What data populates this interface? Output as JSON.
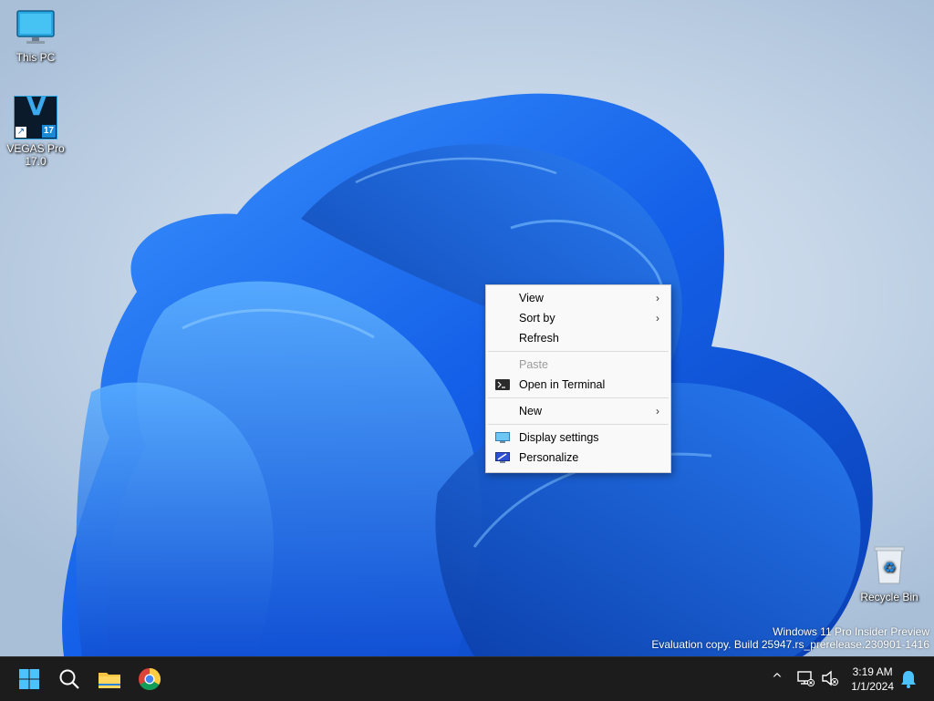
{
  "desktop": {
    "icons": {
      "this_pc": "This PC",
      "vegas_line1": "VEGAS Pro",
      "vegas_line2": "17.0",
      "vegas_badge": "17",
      "vegas_letter": "V",
      "recycle_bin": "Recycle Bin"
    },
    "watermark": {
      "line1": "Windows 11 Pro Insider Preview",
      "line2": "Evaluation copy. Build 25947.rs_prerelease.230901-1416"
    }
  },
  "context_menu": {
    "view": "View",
    "sort_by": "Sort by",
    "refresh": "Refresh",
    "paste": "Paste",
    "open_in_terminal": "Open in Terminal",
    "new": "New",
    "display_settings": "Display settings",
    "personalize": "Personalize",
    "submenu_glyph": "›"
  },
  "taskbar": {
    "apps": [
      "start-icon",
      "search-icon",
      "file-explorer-icon",
      "chrome-icon"
    ],
    "tray": {
      "overflow_glyph": "^",
      "time": "3:19 AM",
      "date": "1/1/2024"
    }
  },
  "colors": {
    "taskbar": "#1c1c1c",
    "accent": "#0067c0",
    "bloom": "#1e6ff0"
  }
}
